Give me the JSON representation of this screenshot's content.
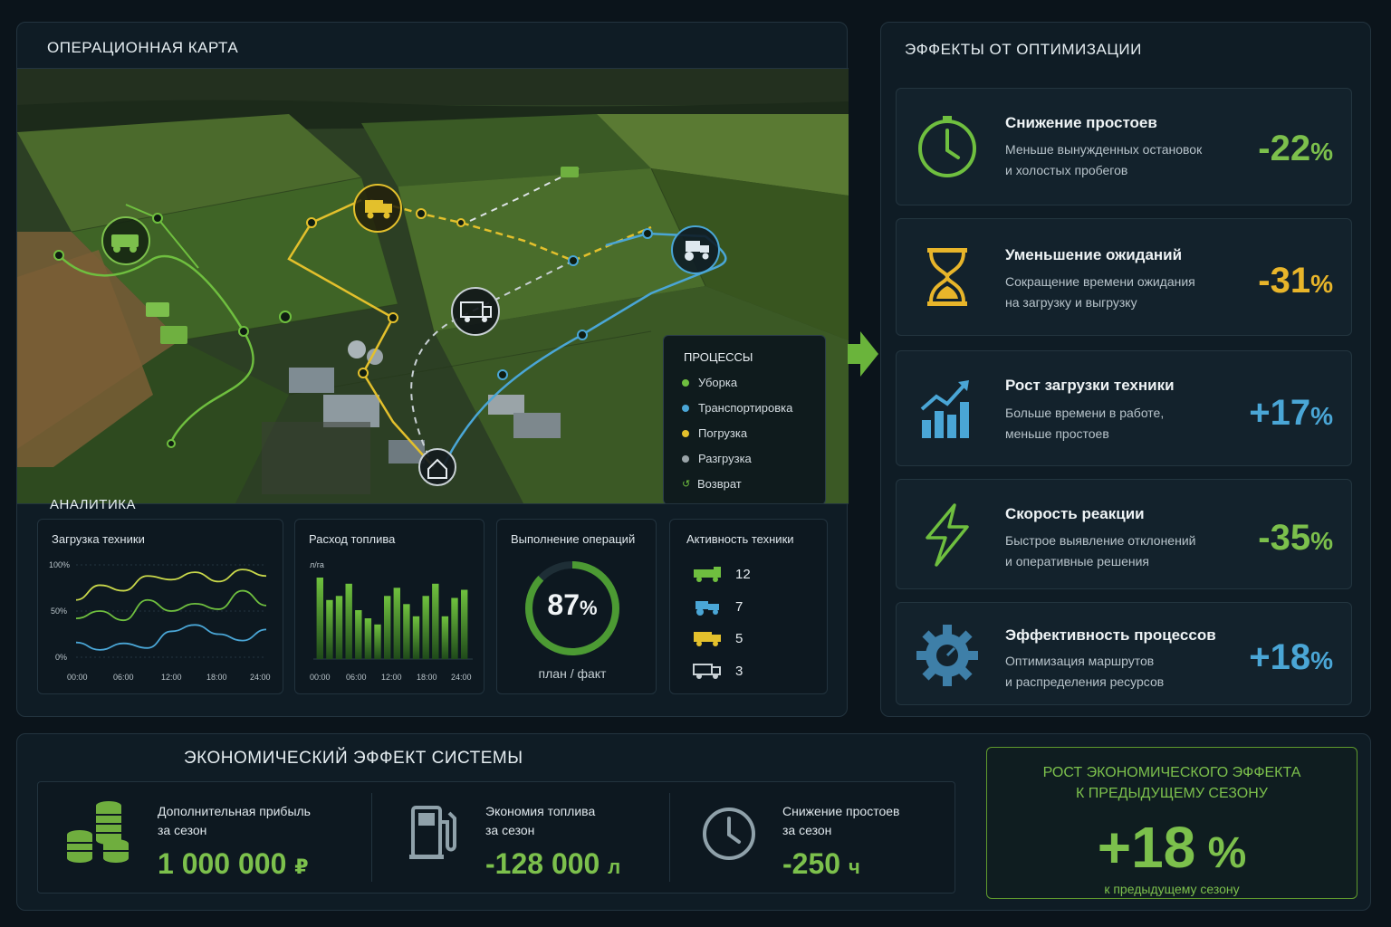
{
  "map": {
    "title": "ОПЕРАЦИОННАЯ КАРТА",
    "legend": {
      "title": "ПРОЦЕССЫ",
      "items": [
        {
          "label": "Уборка",
          "color": "#6fbf3f"
        },
        {
          "label": "Транспортировка",
          "color": "#4aa6d6"
        },
        {
          "label": "Погрузка",
          "color": "#e3c02c"
        },
        {
          "label": "Разгрузка",
          "color": "#9aa4a8"
        },
        {
          "label": "Возврат",
          "color": "#6fbf3f"
        }
      ]
    }
  },
  "analytics": {
    "title": "АНАЛИТИКА",
    "load": {
      "title": "Загрузка техники",
      "y_ticks": [
        "100%",
        "50%",
        "0%"
      ],
      "x_ticks": [
        "00:00",
        "06:00",
        "12:00",
        "18:00",
        "24:00"
      ]
    },
    "fuel": {
      "title": "Расход топлива",
      "unit": "л/га",
      "x_ticks": [
        "00:00",
        "06:00",
        "12:00",
        "18:00",
        "24:00"
      ]
    },
    "ops": {
      "title": "Выполнение операций",
      "value": "87",
      "unit": "%",
      "caption": "план / факт",
      "fraction": 0.87
    },
    "activity": {
      "title": "Активность техники",
      "items": [
        {
          "icon": "harvester-icon",
          "count": "12",
          "color": "#6fbf3f"
        },
        {
          "icon": "tractor-icon",
          "count": "7",
          "color": "#4aa6d6"
        },
        {
          "icon": "truck-icon",
          "count": "5",
          "color": "#e3c02c"
        },
        {
          "icon": "van-icon",
          "count": "3",
          "color": "#c9d1d5"
        }
      ]
    }
  },
  "chart_data": [
    {
      "type": "line",
      "title": "Загрузка техники",
      "x": [
        "00:00",
        "03:00",
        "06:00",
        "09:00",
        "12:00",
        "15:00",
        "18:00",
        "21:00",
        "24:00"
      ],
      "ylim": [
        0,
        100
      ],
      "series": [
        {
          "color": "#c9d84a",
          "values": [
            62,
            78,
            72,
            88,
            84,
            92,
            82,
            95,
            88
          ]
        },
        {
          "color": "#6fbf3f",
          "values": [
            42,
            50,
            40,
            62,
            50,
            58,
            52,
            72,
            56
          ]
        },
        {
          "color": "#4aa6d6",
          "values": [
            16,
            8,
            15,
            10,
            28,
            35,
            25,
            18,
            30
          ]
        }
      ]
    },
    {
      "type": "bar",
      "title": "Расход топлива",
      "ylabel": "л/га",
      "values": [
        80,
        58,
        62,
        74,
        48,
        40,
        34,
        62,
        70,
        54,
        42,
        62,
        74,
        42,
        60,
        68
      ]
    }
  ],
  "effects": {
    "title": "ЭФФЕКТЫ ОТ ОПТИМИЗАЦИИ",
    "items": [
      {
        "title": "Снижение простоев",
        "desc1": "Меньше вынужденных остановок",
        "desc2": "и холостых пробегов",
        "value": "-22",
        "unit": "%",
        "color": "#7cc04c",
        "icon": "clock-icon"
      },
      {
        "title": "Уменьшение ожиданий",
        "desc1": "Сокращение времени ожидания",
        "desc2": "на загрузку и выгрузку",
        "value": "-31",
        "unit": "%",
        "color": "#e8b52a",
        "icon": "hourglass-icon"
      },
      {
        "title": "Рост загрузки техники",
        "desc1": "Больше времени в работе,",
        "desc2": "меньше простоев",
        "value": "+17",
        "unit": "%",
        "color": "#4aa6d6",
        "icon": "growth-chart-icon"
      },
      {
        "title": "Скорость реакции",
        "desc1": "Быстрое выявление отклонений",
        "desc2": "и оперативные решения",
        "value": "-35",
        "unit": "%",
        "color": "#7cc04c",
        "icon": "lightning-icon"
      },
      {
        "title": "Эффективность процессов",
        "desc1": "Оптимизация маршрутов",
        "desc2": "и распределения ресурсов",
        "value": "+18",
        "unit": "%",
        "color": "#4aa6d6",
        "icon": "gear-icon"
      }
    ]
  },
  "economy": {
    "title": "ЭКОНОМИЧЕСКИЙ ЭФФЕКТ СИСТЕМЫ",
    "items": [
      {
        "label1": "Дополнительная прибыль",
        "label2": "за сезон",
        "value": "1 000 000",
        "unit": "₽",
        "icon": "coins-icon"
      },
      {
        "label1": "Экономия топлива",
        "label2": "за сезон",
        "value": "-128 000",
        "unit": "л",
        "icon": "fuel-pump-icon"
      },
      {
        "label1": "Снижение простоев",
        "label2": "за сезон",
        "value": "-250",
        "unit": "ч",
        "icon": "clock-icon"
      }
    ],
    "growth": {
      "title1": "РОСТ ЭКОНОМИЧЕСКОГО ЭФФЕКТА",
      "title2": "К ПРЕДЫДУЩЕМУ СЕЗОНУ",
      "value": "+18",
      "unit": "%",
      "caption": "к предыдущему сезону"
    }
  }
}
